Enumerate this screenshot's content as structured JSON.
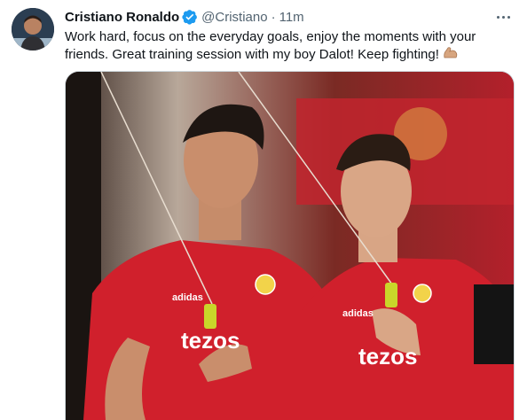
{
  "author": {
    "name": "Cristiano Ronaldo",
    "handle": "@Cristiano",
    "separator": "·",
    "time": "11m",
    "verified": true
  },
  "tweet": {
    "text": "Work hard, focus on the everyday goals, enjoy the moments with your friends. Great training session with my boy Dalot! Keep fighting!",
    "emoji": "flexed-biceps"
  },
  "media": {
    "jersey_sponsor_left": "tezos",
    "jersey_sponsor_right": "tezos",
    "brand": "adidas",
    "colors": {
      "jersey_red": "#d0202c",
      "handle_yellow": "#c9d62a",
      "background": "#8c1d1d"
    }
  },
  "colors": {
    "verified": "#1d9bf0",
    "secondary_text": "#536471",
    "primary_text": "#0f1419"
  }
}
